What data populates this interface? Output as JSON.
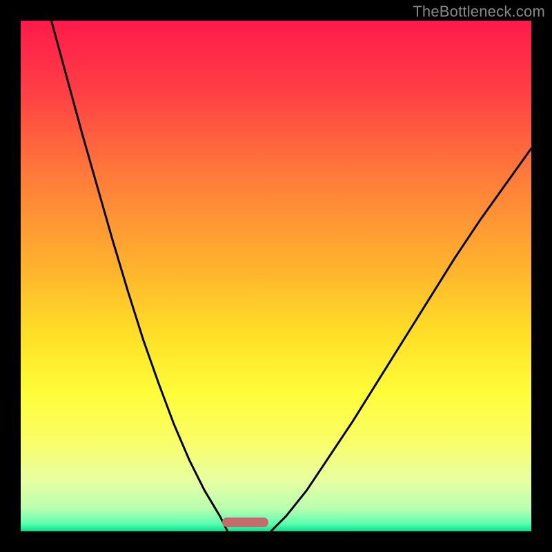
{
  "watermark": "TheBottleneck.com",
  "marker": {
    "color": "#c76a6c",
    "left_frac": 0.395,
    "width_frac": 0.09,
    "bottom_offset_frac": 0.008
  },
  "gradient_stops": [
    {
      "pos": 0.0,
      "color": "#ff1a4b"
    },
    {
      "pos": 0.14,
      "color": "#ff3f45"
    },
    {
      "pos": 0.3,
      "color": "#ff7a3a"
    },
    {
      "pos": 0.48,
      "color": "#ffb12e"
    },
    {
      "pos": 0.62,
      "color": "#ffe127"
    },
    {
      "pos": 0.73,
      "color": "#fffd3a"
    },
    {
      "pos": 0.82,
      "color": "#fafd65"
    },
    {
      "pos": 0.9,
      "color": "#e8ffa2"
    },
    {
      "pos": 0.955,
      "color": "#b9ffb0"
    },
    {
      "pos": 0.985,
      "color": "#5dffb0"
    },
    {
      "pos": 1.0,
      "color": "#00e28a"
    }
  ],
  "chart_data": {
    "type": "line",
    "title": "",
    "xlabel": "",
    "ylabel": "",
    "xlim": [
      0,
      100
    ],
    "ylim": [
      0,
      100
    ],
    "series": [
      {
        "name": "left-curve",
        "x": [
          6,
          9,
          12,
          15,
          18,
          21,
          24,
          27,
          30,
          33,
          36,
          39,
          40.5
        ],
        "y": [
          100,
          89,
          78,
          67.5,
          57,
          47,
          37.5,
          29,
          21,
          14,
          8,
          3,
          0
        ]
      },
      {
        "name": "right-curve",
        "x": [
          49,
          52,
          56,
          60,
          65,
          70,
          75,
          80,
          85,
          90,
          95,
          100
        ],
        "y": [
          0,
          3,
          8,
          14,
          21.5,
          29.5,
          37.5,
          45.5,
          53.5,
          61,
          68,
          75
        ]
      }
    ],
    "marker_region": {
      "x_start": 39.5,
      "x_end": 48.5,
      "y": 0
    }
  }
}
